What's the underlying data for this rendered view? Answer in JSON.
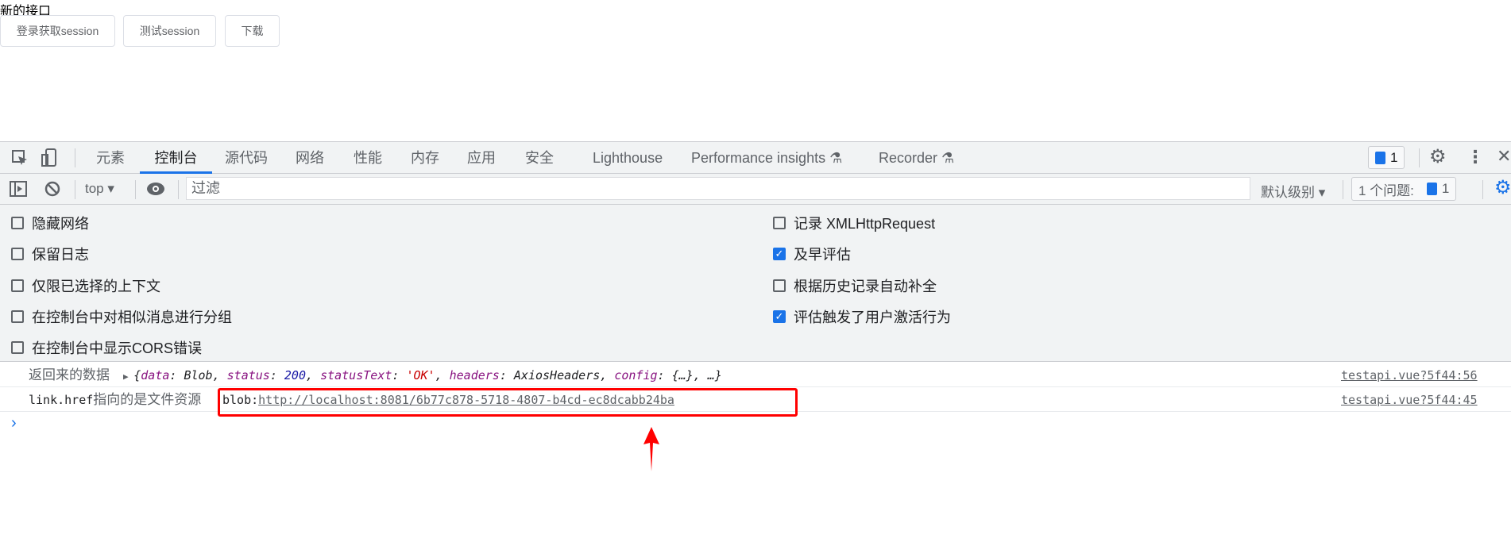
{
  "page": {
    "title": "新的接口",
    "buttons": [
      "登录获取session",
      "测试session",
      "下载"
    ]
  },
  "devtools": {
    "tabs": [
      "元素",
      "控制台",
      "源代码",
      "网络",
      "性能",
      "内存",
      "应用",
      "安全",
      "Lighthouse",
      "Performance insights",
      "Recorder"
    ],
    "active_tab": "控制台",
    "issues_badge_count": "1",
    "toolbar": {
      "context": "top",
      "filter_placeholder": "过滤",
      "level": "默认级别",
      "issues_label": "1 个问题:",
      "issues_count": "1"
    },
    "settings": [
      {
        "label": "隐藏网络",
        "checked": false
      },
      {
        "label": "保留日志",
        "checked": false
      },
      {
        "label": "仅限已选择的上下文",
        "checked": false
      },
      {
        "label": "在控制台中对相似消息进行分组",
        "checked": false
      },
      {
        "label": "在控制台中显示CORS错误",
        "checked": false
      },
      {
        "label": "记录 XMLHttpRequest",
        "checked": false
      },
      {
        "label": "及早评估",
        "checked": true
      },
      {
        "label": "根据历史记录自动补全",
        "checked": false
      },
      {
        "label": "评估触发了用户激活行为",
        "checked": true
      }
    ],
    "messages": [
      {
        "label": "返回来的数据",
        "obj_open": "{",
        "k1": "data",
        "v1": "Blob",
        "k2": "status",
        "v2": "200",
        "k3": "statusText",
        "v3": "'OK'",
        "k4": "headers",
        "v4": "AxiosHeaders",
        "k5": "config",
        "v5": "{…}",
        "rest": "…}",
        "source": "testapi.vue?5f44:56"
      },
      {
        "label_code": "link.href",
        "label": "指向的是文件资源",
        "blob_prefix": "blob:",
        "url": "http://localhost:8081/6b77c878-5718-4807-b4cd-ec8dcabb24ba",
        "source": "testapi.vue?5f44:45"
      }
    ],
    "prompt": "›"
  },
  "annotation": {
    "color": "#ff0000"
  }
}
